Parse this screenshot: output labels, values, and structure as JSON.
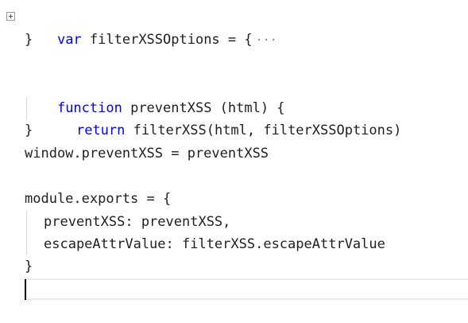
{
  "code": {
    "line1": {
      "keyword": "var",
      "rest": " filterXSSOptions = {",
      "folded_marker": "···"
    },
    "line2": "}",
    "line4": {
      "keyword": "function",
      "rest": " preventXSS (html) {"
    },
    "line5": {
      "keyword": "return",
      "rest": " filterXSS(html, filterXSSOptions)"
    },
    "line6": "}",
    "line7": "window.preventXSS = preventXSS",
    "line9": "module.exports = {",
    "line10": "preventXSS: preventXSS,",
    "line11": "escapeAttrValue: filterXSS.escapeAttrValue",
    "line12": "}"
  },
  "icons": {
    "fold": "plus-box-icon"
  }
}
